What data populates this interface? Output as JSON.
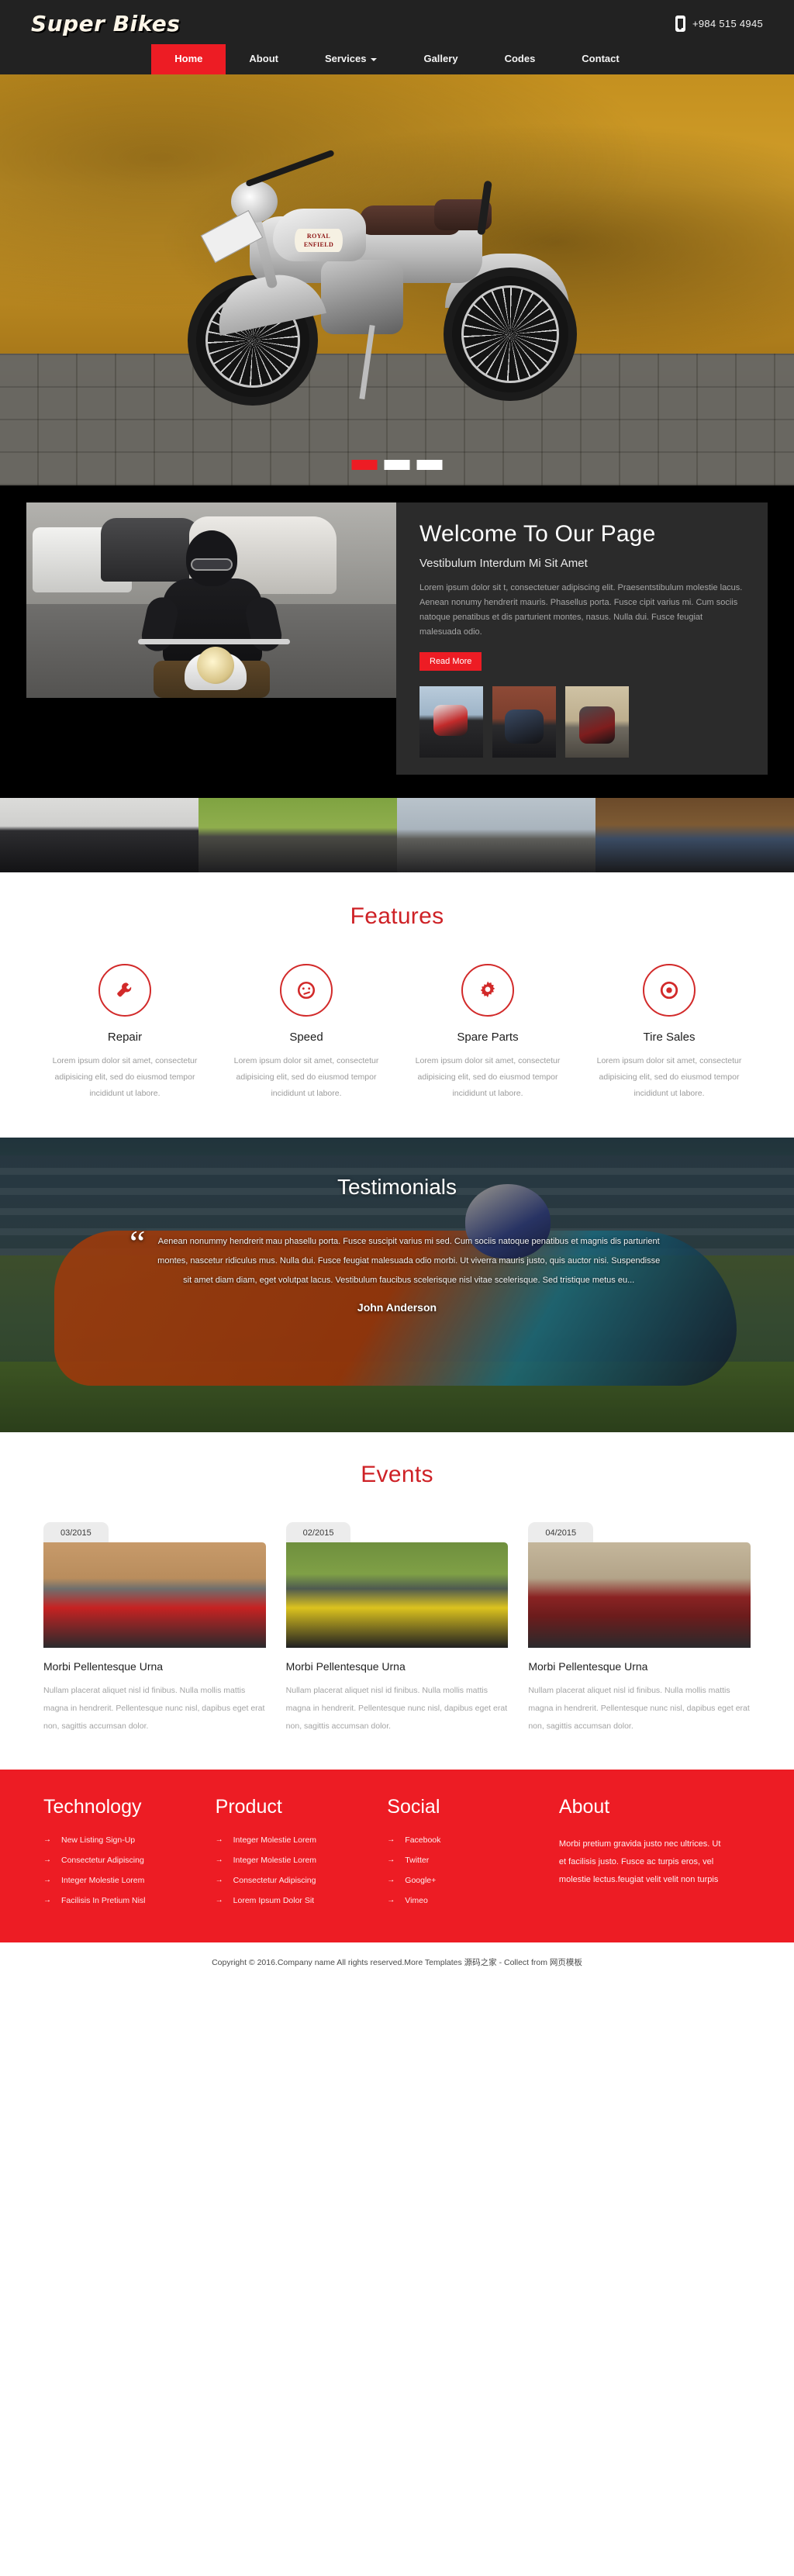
{
  "header": {
    "logo": "Super Bikes",
    "phone": "+984 515 4945",
    "phone_icon": "mobile-phone-icon",
    "nav": [
      {
        "label": "Home",
        "active": true,
        "dropdown": false
      },
      {
        "label": "About",
        "active": false,
        "dropdown": false
      },
      {
        "label": "Services",
        "active": false,
        "dropdown": true
      },
      {
        "label": "Gallery",
        "active": false,
        "dropdown": false
      },
      {
        "label": "Codes",
        "active": false,
        "dropdown": false
      },
      {
        "label": "Contact",
        "active": false,
        "dropdown": false
      }
    ]
  },
  "hero": {
    "slide_alt": "Royal Enfield motorcycle against yellow wall",
    "badge_text": "ROYAL ENFIELD",
    "slides": [
      {
        "active": true
      },
      {
        "active": false
      },
      {
        "active": false
      }
    ]
  },
  "welcome": {
    "photo_alt": "Motorcyclist riding in traffic",
    "title": "Welcome To Our Page",
    "subtitle": "Vestibulum Interdum Mi Sit Amet",
    "paragraph": "Lorem ipsum dolor sit t, consectetuer adipiscing elit. Praesentstibulum molestie lacus. Aenean nonumy hendrerit mauris. Phasellus porta. Fusce cipit varius mi. Cum sociis natoque penatibus et dis parturient montes, nasus. Nulla dui. Fusce feugiat malesuada odio.",
    "read_more": "Read More",
    "thumbs": [
      {
        "alt": "Rider on sport bike"
      },
      {
        "alt": "Black cruiser by brick wall"
      },
      {
        "alt": "Motorcycle by stone wall"
      }
    ]
  },
  "gallery": {
    "items": [
      {
        "alt": "Two riders on touring bike"
      },
      {
        "alt": "Chopper on grass"
      },
      {
        "alt": "Quad bike rider"
      },
      {
        "alt": "Blue sport bike"
      }
    ]
  },
  "features": {
    "title": "Features",
    "items": [
      {
        "icon": "wrench-icon",
        "title": "Repair",
        "desc": "Lorem ipsum dolor sit amet, consectetur adipisicing elit, sed do eiusmod tempor incididunt ut labore."
      },
      {
        "icon": "speedometer-icon",
        "title": "Speed",
        "desc": "Lorem ipsum dolor sit amet, consectetur adipisicing elit, sed do eiusmod tempor incididunt ut labore."
      },
      {
        "icon": "gear-icon",
        "title": "Spare Parts",
        "desc": "Lorem ipsum dolor sit amet, consectetur adipisicing elit, sed do eiusmod tempor incididunt ut labore."
      },
      {
        "icon": "target-icon",
        "title": "Tire Sales",
        "desc": "Lorem ipsum dolor sit amet, consectetur adipisicing elit, sed do eiusmod tempor incididunt ut labore."
      }
    ]
  },
  "testimonials": {
    "title": "Testimonials",
    "quote_mark": "“",
    "quote": "Aenean nonummy hendrerit mau phasellu porta. Fusce suscipit varius mi sed. Cum sociis natoque penatibus et magnis dis parturient montes, nascetur ridiculus mus. Nulla dui. Fusce feugiat malesuada odio morbi. Ut viverra mauris justo, quis auctor nisi. Suspendisse sit amet diam diam, eget volutpat lacus. Vestibulum faucibus scelerisque nisl vitae scelerisque. Sed tristique metus eu...",
    "author": "John Anderson",
    "background_alt": "Orange racing motorcycle leaning into turn"
  },
  "events": {
    "title": "Events",
    "items": [
      {
        "date": "03/2015",
        "title": "Morbi Pellentesque Urna",
        "desc": "Nullam placerat aliquet nisl id finibus. Nulla mollis mattis magna in hendrerit. Pellentesque nunc nisl, dapibus eget erat non, sagittis accumsan dolor.",
        "img_alt": "Red racing motorcycle"
      },
      {
        "date": "02/2015",
        "title": "Morbi Pellentesque Urna",
        "desc": "Nullam placerat aliquet nisl id finibus. Nulla mollis mattis magna in hendrerit. Pellentesque nunc nisl, dapibus eget erat non, sagittis accumsan dolor.",
        "img_alt": "Yellow racing motorcycle"
      },
      {
        "date": "04/2015",
        "title": "Morbi Pellentesque Urna",
        "desc": "Nullam placerat aliquet nisl id finibus. Nulla mollis mattis magna in hendrerit. Pellentesque nunc nisl, dapibus eget erat non, sagittis accumsan dolor.",
        "img_alt": "Red cruiser motorcycle"
      }
    ]
  },
  "footer": {
    "arrow": "→",
    "columns": [
      {
        "title": "Technology",
        "links": [
          "New Listing Sign-Up",
          "Consectetur Adipiscing",
          "Integer Molestie Lorem",
          "Facilisis In Pretium Nisl"
        ]
      },
      {
        "title": "Product",
        "links": [
          "Integer Molestie Lorem",
          "Integer Molestie Lorem",
          "Consectetur Adipiscing",
          "Lorem Ipsum Dolor Sit"
        ]
      },
      {
        "title": "Social",
        "links": [
          "Facebook",
          "Twitter",
          "Google+",
          "Vimeo"
        ]
      }
    ],
    "about": {
      "title": "About",
      "text": "Morbi pretium gravida justo nec ultrices. Ut et facilisis justo. Fusce ac turpis eros, vel molestie lectus.feugiat velit velit non turpis"
    }
  },
  "copyright": {
    "text": "Copyright © 2016.Company name All rights reserved.More Templates  源码之家  - Collect from  网页模板"
  },
  "colors": {
    "accent_red": "#ED1C24",
    "header_dark": "#222222",
    "panel_dark": "#2B2B2B",
    "title_red": "#CE2126"
  }
}
